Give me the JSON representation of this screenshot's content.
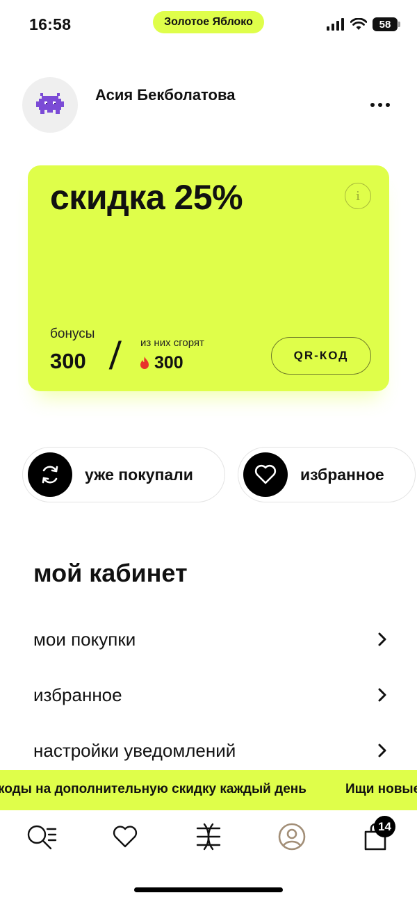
{
  "status_bar": {
    "time": "16:58",
    "app_name": "Золотое Яблоко",
    "battery": "58",
    "icons": [
      "signal-icon",
      "wifi-icon",
      "battery-icon"
    ]
  },
  "profile": {
    "name": "Асия Бекболатова",
    "avatar_icon": "pixel-alien-icon",
    "menu_icon": "more-dots-icon"
  },
  "discount_card": {
    "title": "скидка 25%",
    "bonus_label": "бонусы",
    "bonus_value": "300",
    "separator": "/",
    "burn_label": "из них сгорят",
    "burn_value": "300",
    "qr_button": "QR-КОД",
    "info_icon": "info-icon",
    "fire_icon": "fire-icon",
    "color": "#dffe4a"
  },
  "quick_actions": [
    {
      "label": "уже покупали",
      "icon": "repeat-arrows-icon"
    },
    {
      "label": "избранное",
      "icon": "heart-icon"
    }
  ],
  "cabinet": {
    "title": "мой кабинет",
    "items": [
      {
        "label": "мои покупки"
      },
      {
        "label": "избранное"
      },
      {
        "label": "настройки уведомлений"
      }
    ]
  },
  "banner": {
    "text_1": "коды на дополнительную скидку каждый день",
    "text_2": "Ищи новые"
  },
  "tab_bar": {
    "tabs": [
      "search-icon",
      "heart-icon",
      "catalog-icon",
      "profile-icon",
      "cart-icon"
    ],
    "cart_count": "14",
    "active_color": "#a28e77"
  }
}
